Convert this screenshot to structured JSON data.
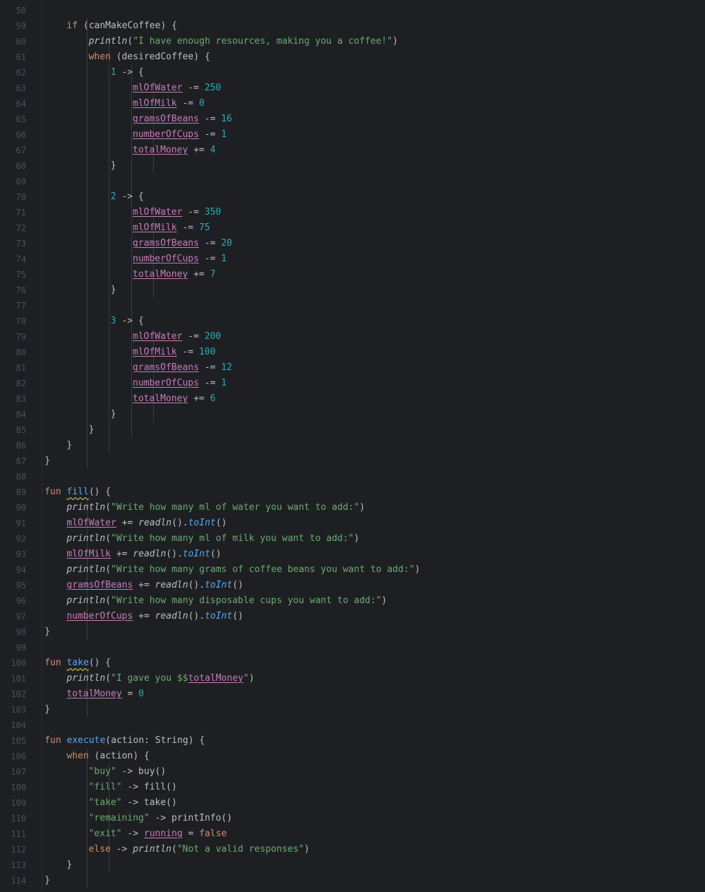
{
  "editor": {
    "theme_colors": {
      "background": "#1e1f22",
      "keyword": "#cf8e6d",
      "number": "#2aacb8",
      "string": "#6aab73",
      "property": "#c77dbb",
      "function_decl": "#56a8f5",
      "line_number": "#4b5059"
    },
    "lines": [
      {
        "n": "58",
        "indent": 0,
        "tokens": []
      },
      {
        "n": "59",
        "indent": 2,
        "tokens": [
          {
            "t": "kw",
            "v": "if"
          },
          {
            "t": "plain",
            "v": " (canMakeCoffee) {"
          }
        ]
      },
      {
        "n": "60",
        "indent": 3,
        "tokens": [
          {
            "t": "fn-it",
            "v": "println"
          },
          {
            "t": "plain",
            "v": "("
          },
          {
            "t": "str",
            "v": "\"I have enough resources, making you a coffee!\""
          },
          {
            "t": "plain",
            "v": ")"
          }
        ]
      },
      {
        "n": "61",
        "indent": 3,
        "tokens": [
          {
            "t": "kw",
            "v": "when"
          },
          {
            "t": "plain",
            "v": " (desiredCoffee) {"
          }
        ]
      },
      {
        "n": "62",
        "indent": 4,
        "tokens": [
          {
            "t": "num",
            "v": "1"
          },
          {
            "t": "plain",
            "v": " -> {"
          }
        ]
      },
      {
        "n": "63",
        "indent": 5,
        "tokens": [
          {
            "t": "prop",
            "v": "mlOfWater"
          },
          {
            "t": "plain",
            "v": " -= "
          },
          {
            "t": "num",
            "v": "250"
          }
        ]
      },
      {
        "n": "64",
        "indent": 5,
        "tokens": [
          {
            "t": "prop",
            "v": "mlOfMilk"
          },
          {
            "t": "plain",
            "v": " -= "
          },
          {
            "t": "num",
            "v": "0"
          }
        ]
      },
      {
        "n": "65",
        "indent": 5,
        "tokens": [
          {
            "t": "prop",
            "v": "gramsOfBeans"
          },
          {
            "t": "plain",
            "v": " -= "
          },
          {
            "t": "num",
            "v": "16"
          }
        ]
      },
      {
        "n": "66",
        "indent": 5,
        "tokens": [
          {
            "t": "prop",
            "v": "numberOfCups"
          },
          {
            "t": "plain",
            "v": " -= "
          },
          {
            "t": "num",
            "v": "1"
          }
        ]
      },
      {
        "n": "67",
        "indent": 5,
        "tokens": [
          {
            "t": "prop",
            "v": "totalMoney"
          },
          {
            "t": "plain",
            "v": " += "
          },
          {
            "t": "num",
            "v": "4"
          }
        ]
      },
      {
        "n": "68",
        "indent": 4,
        "tokens": [
          {
            "t": "plain",
            "v": "}"
          }
        ]
      },
      {
        "n": "69",
        "indent": 0,
        "tokens": []
      },
      {
        "n": "70",
        "indent": 4,
        "tokens": [
          {
            "t": "num",
            "v": "2"
          },
          {
            "t": "plain",
            "v": " -> {"
          }
        ]
      },
      {
        "n": "71",
        "indent": 5,
        "tokens": [
          {
            "t": "prop",
            "v": "mlOfWater"
          },
          {
            "t": "plain",
            "v": " -= "
          },
          {
            "t": "num",
            "v": "350"
          }
        ]
      },
      {
        "n": "72",
        "indent": 5,
        "tokens": [
          {
            "t": "prop",
            "v": "mlOfMilk"
          },
          {
            "t": "plain",
            "v": " -= "
          },
          {
            "t": "num",
            "v": "75"
          }
        ]
      },
      {
        "n": "73",
        "indent": 5,
        "tokens": [
          {
            "t": "prop",
            "v": "gramsOfBeans"
          },
          {
            "t": "plain",
            "v": " -= "
          },
          {
            "t": "num",
            "v": "20"
          }
        ]
      },
      {
        "n": "74",
        "indent": 5,
        "tokens": [
          {
            "t": "prop",
            "v": "numberOfCups"
          },
          {
            "t": "plain",
            "v": " -= "
          },
          {
            "t": "num",
            "v": "1"
          }
        ]
      },
      {
        "n": "75",
        "indent": 5,
        "tokens": [
          {
            "t": "prop",
            "v": "totalMoney"
          },
          {
            "t": "plain",
            "v": " += "
          },
          {
            "t": "num",
            "v": "7"
          }
        ]
      },
      {
        "n": "76",
        "indent": 4,
        "tokens": [
          {
            "t": "plain",
            "v": "}"
          }
        ]
      },
      {
        "n": "77",
        "indent": 0,
        "tokens": []
      },
      {
        "n": "78",
        "indent": 4,
        "tokens": [
          {
            "t": "num",
            "v": "3"
          },
          {
            "t": "plain",
            "v": " -> {"
          }
        ]
      },
      {
        "n": "79",
        "indent": 5,
        "tokens": [
          {
            "t": "prop",
            "v": "mlOfWater"
          },
          {
            "t": "plain",
            "v": " -= "
          },
          {
            "t": "num",
            "v": "200"
          }
        ]
      },
      {
        "n": "80",
        "indent": 5,
        "tokens": [
          {
            "t": "prop",
            "v": "mlOfMilk"
          },
          {
            "t": "plain",
            "v": " -= "
          },
          {
            "t": "num",
            "v": "100"
          }
        ]
      },
      {
        "n": "81",
        "indent": 5,
        "tokens": [
          {
            "t": "prop",
            "v": "gramsOfBeans"
          },
          {
            "t": "plain",
            "v": " -= "
          },
          {
            "t": "num",
            "v": "12"
          }
        ]
      },
      {
        "n": "82",
        "indent": 5,
        "tokens": [
          {
            "t": "prop",
            "v": "numberOfCups"
          },
          {
            "t": "plain",
            "v": " -= "
          },
          {
            "t": "num",
            "v": "1"
          }
        ]
      },
      {
        "n": "83",
        "indent": 5,
        "tokens": [
          {
            "t": "prop",
            "v": "totalMoney"
          },
          {
            "t": "plain",
            "v": " += "
          },
          {
            "t": "num",
            "v": "6"
          }
        ]
      },
      {
        "n": "84",
        "indent": 4,
        "tokens": [
          {
            "t": "plain",
            "v": "}"
          }
        ]
      },
      {
        "n": "85",
        "indent": 3,
        "tokens": [
          {
            "t": "plain",
            "v": "}"
          }
        ]
      },
      {
        "n": "86",
        "indent": 2,
        "tokens": [
          {
            "t": "plain",
            "v": "}"
          }
        ]
      },
      {
        "n": "87",
        "indent": 1,
        "tokens": [
          {
            "t": "plain",
            "v": "}"
          }
        ]
      },
      {
        "n": "88",
        "indent": 0,
        "tokens": []
      },
      {
        "n": "89",
        "indent": 1,
        "tokens": [
          {
            "t": "kw",
            "v": "fun"
          },
          {
            "t": "plain",
            "v": " "
          },
          {
            "t": "fndecl squig",
            "v": "fill"
          },
          {
            "t": "plain",
            "v": "() {"
          }
        ]
      },
      {
        "n": "90",
        "indent": 2,
        "tokens": [
          {
            "t": "fn-it",
            "v": "println"
          },
          {
            "t": "plain",
            "v": "("
          },
          {
            "t": "str",
            "v": "\"Write how many ml of water you want to add:\""
          },
          {
            "t": "plain",
            "v": ")"
          }
        ]
      },
      {
        "n": "91",
        "indent": 2,
        "tokens": [
          {
            "t": "prop",
            "v": "mlOfWater"
          },
          {
            "t": "plain",
            "v": " += "
          },
          {
            "t": "fn-it",
            "v": "readln"
          },
          {
            "t": "plain",
            "v": "()."
          },
          {
            "t": "ext",
            "v": "toInt"
          },
          {
            "t": "plain",
            "v": "()"
          }
        ]
      },
      {
        "n": "92",
        "indent": 2,
        "tokens": [
          {
            "t": "fn-it",
            "v": "println"
          },
          {
            "t": "plain",
            "v": "("
          },
          {
            "t": "str",
            "v": "\"Write how many ml of milk you want to add:\""
          },
          {
            "t": "plain",
            "v": ")"
          }
        ]
      },
      {
        "n": "93",
        "indent": 2,
        "tokens": [
          {
            "t": "prop",
            "v": "mlOfMilk"
          },
          {
            "t": "plain",
            "v": " += "
          },
          {
            "t": "fn-it",
            "v": "readln"
          },
          {
            "t": "plain",
            "v": "()."
          },
          {
            "t": "ext",
            "v": "toInt"
          },
          {
            "t": "plain",
            "v": "()"
          }
        ]
      },
      {
        "n": "94",
        "indent": 2,
        "tokens": [
          {
            "t": "fn-it",
            "v": "println"
          },
          {
            "t": "plain",
            "v": "("
          },
          {
            "t": "str",
            "v": "\"Write how many grams of coffee beans you want to add:\""
          },
          {
            "t": "plain",
            "v": ")"
          }
        ]
      },
      {
        "n": "95",
        "indent": 2,
        "tokens": [
          {
            "t": "prop",
            "v": "gramsOfBeans"
          },
          {
            "t": "plain",
            "v": " += "
          },
          {
            "t": "fn-it",
            "v": "readln"
          },
          {
            "t": "plain",
            "v": "()."
          },
          {
            "t": "ext",
            "v": "toInt"
          },
          {
            "t": "plain",
            "v": "()"
          }
        ]
      },
      {
        "n": "96",
        "indent": 2,
        "tokens": [
          {
            "t": "fn-it",
            "v": "println"
          },
          {
            "t": "plain",
            "v": "("
          },
          {
            "t": "str",
            "v": "\"Write how many disposable cups you want to add:\""
          },
          {
            "t": "plain",
            "v": ")"
          }
        ]
      },
      {
        "n": "97",
        "indent": 2,
        "tokens": [
          {
            "t": "prop",
            "v": "numberOfCups"
          },
          {
            "t": "plain",
            "v": " += "
          },
          {
            "t": "fn-it",
            "v": "readln"
          },
          {
            "t": "plain",
            "v": "()."
          },
          {
            "t": "ext",
            "v": "toInt"
          },
          {
            "t": "plain",
            "v": "()"
          }
        ]
      },
      {
        "n": "98",
        "indent": 1,
        "tokens": [
          {
            "t": "plain",
            "v": "}"
          }
        ]
      },
      {
        "n": "99",
        "indent": 0,
        "tokens": []
      },
      {
        "n": "100",
        "indent": 1,
        "tokens": [
          {
            "t": "kw",
            "v": "fun"
          },
          {
            "t": "plain",
            "v": " "
          },
          {
            "t": "fndecl squig",
            "v": "take"
          },
          {
            "t": "plain",
            "v": "() {"
          }
        ]
      },
      {
        "n": "101",
        "indent": 2,
        "tokens": [
          {
            "t": "fn-it",
            "v": "println"
          },
          {
            "t": "plain",
            "v": "("
          },
          {
            "t": "str",
            "v": "\"I gave you $$"
          },
          {
            "t": "prop",
            "v": "totalMoney"
          },
          {
            "t": "str",
            "v": "\""
          },
          {
            "t": "plain",
            "v": ")"
          }
        ]
      },
      {
        "n": "102",
        "indent": 2,
        "tokens": [
          {
            "t": "prop",
            "v": "totalMoney"
          },
          {
            "t": "plain",
            "v": " = "
          },
          {
            "t": "num",
            "v": "0"
          }
        ]
      },
      {
        "n": "103",
        "indent": 1,
        "tokens": [
          {
            "t": "plain",
            "v": "}"
          }
        ]
      },
      {
        "n": "104",
        "indent": 0,
        "tokens": []
      },
      {
        "n": "105",
        "indent": 1,
        "tokens": [
          {
            "t": "kw",
            "v": "fun"
          },
          {
            "t": "plain",
            "v": " "
          },
          {
            "t": "fndecl",
            "v": "execute"
          },
          {
            "t": "plain",
            "v": "(action: String) {"
          }
        ]
      },
      {
        "n": "106",
        "indent": 2,
        "tokens": [
          {
            "t": "kw",
            "v": "when"
          },
          {
            "t": "plain",
            "v": " (action) {"
          }
        ]
      },
      {
        "n": "107",
        "indent": 3,
        "tokens": [
          {
            "t": "str",
            "v": "\"buy\""
          },
          {
            "t": "plain",
            "v": " -> buy()"
          }
        ]
      },
      {
        "n": "108",
        "indent": 3,
        "tokens": [
          {
            "t": "str",
            "v": "\"fill\""
          },
          {
            "t": "plain",
            "v": " -> fill()"
          }
        ]
      },
      {
        "n": "109",
        "indent": 3,
        "tokens": [
          {
            "t": "str",
            "v": "\"take\""
          },
          {
            "t": "plain",
            "v": " -> take()"
          }
        ]
      },
      {
        "n": "110",
        "indent": 3,
        "tokens": [
          {
            "t": "str",
            "v": "\"remaining\""
          },
          {
            "t": "plain",
            "v": " -> printInfo()"
          }
        ]
      },
      {
        "n": "111",
        "indent": 3,
        "tokens": [
          {
            "t": "str",
            "v": "\"exit\""
          },
          {
            "t": "plain",
            "v": " -> "
          },
          {
            "t": "prop",
            "v": "running"
          },
          {
            "t": "plain",
            "v": " = "
          },
          {
            "t": "kw",
            "v": "false"
          }
        ]
      },
      {
        "n": "112",
        "indent": 3,
        "tokens": [
          {
            "t": "kw",
            "v": "else"
          },
          {
            "t": "plain",
            "v": " -> "
          },
          {
            "t": "fn-it",
            "v": "println"
          },
          {
            "t": "plain",
            "v": "("
          },
          {
            "t": "str",
            "v": "\"Not a valid responses\""
          },
          {
            "t": "plain",
            "v": ")"
          }
        ]
      },
      {
        "n": "113",
        "indent": 2,
        "tokens": [
          {
            "t": "plain",
            "v": "}"
          }
        ]
      },
      {
        "n": "114",
        "indent": 1,
        "tokens": [
          {
            "t": "plain",
            "v": "}"
          }
        ]
      }
    ]
  }
}
